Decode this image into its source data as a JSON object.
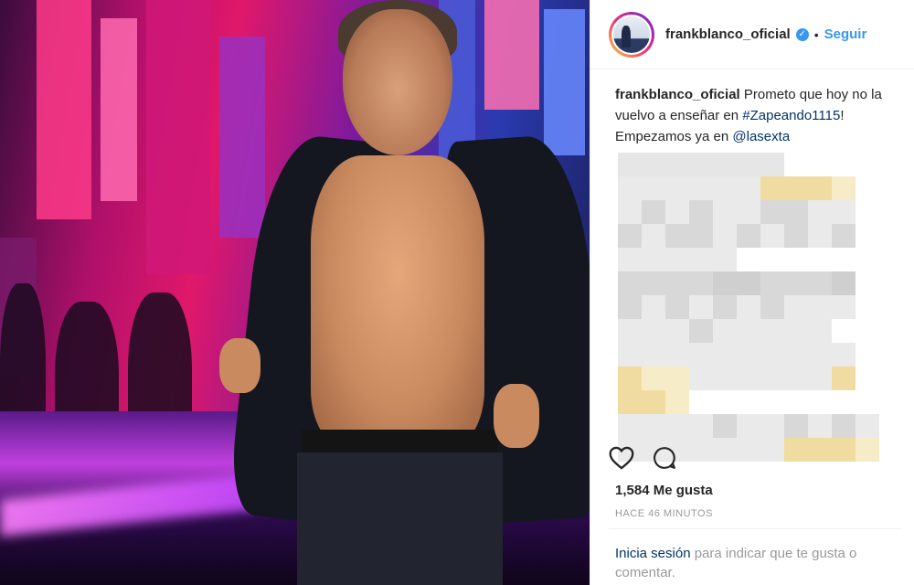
{
  "post": {
    "username": "frankblanco_oficial",
    "verified_icon": "verified-badge-icon",
    "separator": "•",
    "follow_label": "Seguir",
    "caption": {
      "username": "frankblanco_oficial",
      "text_1": " Prometo que hoy no la vuelvo a enseñar en ",
      "hashtag": "#Zapeando1115",
      "text_2": "! Empezamos ya en ",
      "mention": "@lasexta"
    },
    "likes": "1,584 Me gusta",
    "timestamp": "HACE 46 MINUTOS",
    "login_prompt": {
      "link": "Inicia sesión",
      "text": " para indicar que te gusta o comentar."
    }
  },
  "icons": {
    "like": "heart-icon",
    "comment": "comment-icon"
  },
  "colors": {
    "link_blue": "#3897f0",
    "dark_link": "#003569",
    "muted": "#999999"
  }
}
